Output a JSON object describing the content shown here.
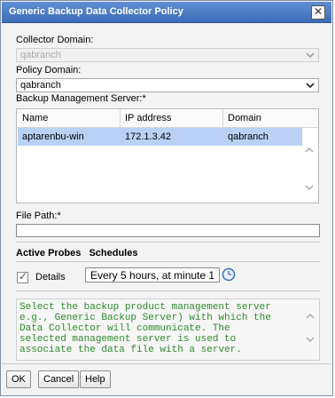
{
  "window": {
    "title": "Generic Backup Data Collector Policy",
    "close_icon": "close-icon"
  },
  "collector_domain": {
    "label": "Collector Domain:",
    "value": "qabranch",
    "disabled": true
  },
  "policy_domain": {
    "label": "Policy Domain:",
    "value": "qabranch"
  },
  "backup_server": {
    "label": "Backup Management Server:*",
    "columns": [
      "Name",
      "IP address",
      "Domain"
    ],
    "rows": [
      {
        "name": "aptarenbu-win",
        "ip": "172.1.3.42",
        "domain": "qabranch",
        "selected": true
      }
    ]
  },
  "file_path": {
    "label": "File Path:*",
    "value": ""
  },
  "tabs": [
    "Active Probes",
    "Schedules"
  ],
  "details": {
    "label": "Details",
    "checked": true,
    "schedule_value": "Every 5 hours, at minute 1",
    "icon": "clock-icon"
  },
  "help_text": "Select the backup product management server\ne.g., Generic Backup Server) with which the\nData Collector will communicate. The\nselected management server is used to\nassociate the data file with a server.",
  "buttons": {
    "ok": "OK",
    "cancel": "Cancel",
    "help": "Help"
  },
  "colors": {
    "title_bar": "#4a7cc7",
    "selected_row": "#b9d1f5",
    "help_text": "#2f8a2f"
  }
}
